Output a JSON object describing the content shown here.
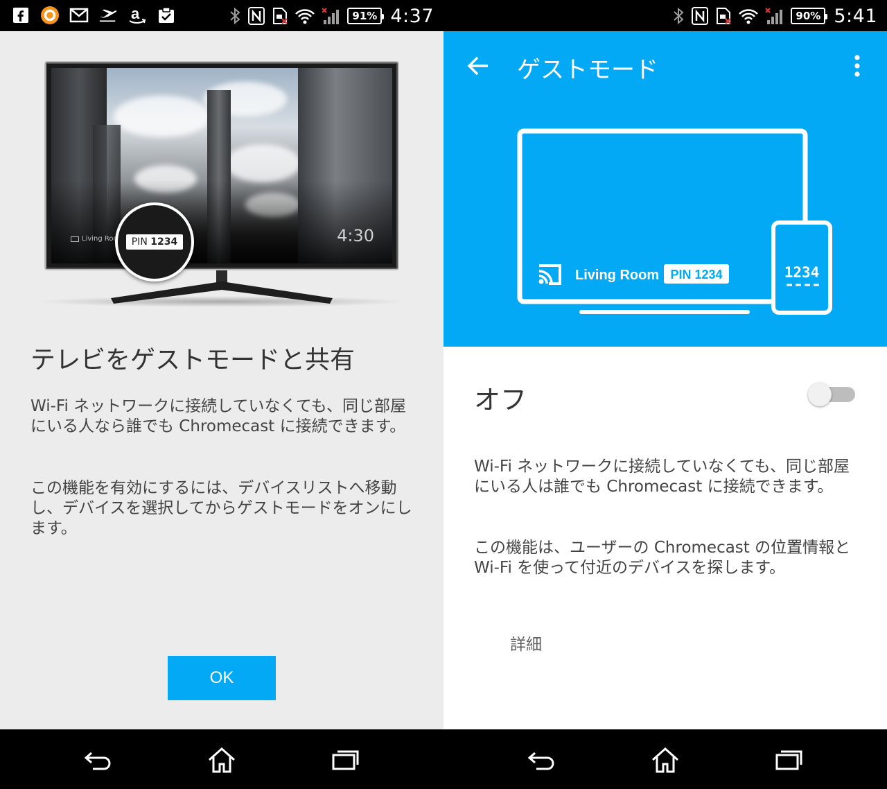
{
  "left_screen": {
    "status_bar": {
      "notification_icons": [
        "facebook-icon",
        "orange-app-icon",
        "gmail-icon",
        "airplane-icon",
        "amazon-icon",
        "clipboard-icon"
      ],
      "battery": "91%",
      "time": "4:37"
    },
    "hero": {
      "device_label": "Living Room",
      "pin_prefix": "PIN",
      "pin_code": "1234",
      "tv_clock": "4:30"
    },
    "title": "テレビをゲストモードと共有",
    "body_1": "Wi-Fi ネットワークに接続していなくても、同じ部屋にいる人なら誰でも Chromecast に接続できます。",
    "body_2": "この機能を有効にするには、デバイスリストへ移動し、デバイスを選択してからゲストモードをオンにします。",
    "ok_label": "OK"
  },
  "right_screen": {
    "status_bar": {
      "battery": "90%",
      "time": "5:41"
    },
    "app_bar": {
      "title": "ゲストモード"
    },
    "illustration": {
      "device_label": "Living Room",
      "pin_label": "PIN 1234",
      "phone_code": "1234"
    },
    "status_label": "オフ",
    "toggle_on": false,
    "body_1": "Wi-Fi ネットワークに接続していなくても、同じ部屋にいる人は誰でも Chromecast に接続できます。",
    "body_2": "この機能は、ユーザーの Chromecast の位置情報と Wi-Fi を使って付近のデバイスを探します。",
    "details_label": "詳細"
  },
  "colors": {
    "accent": "#03a9f4",
    "left_background": "#ececec",
    "right_background": "#ffffff",
    "toggle_track_off": "#bdbdbd"
  }
}
